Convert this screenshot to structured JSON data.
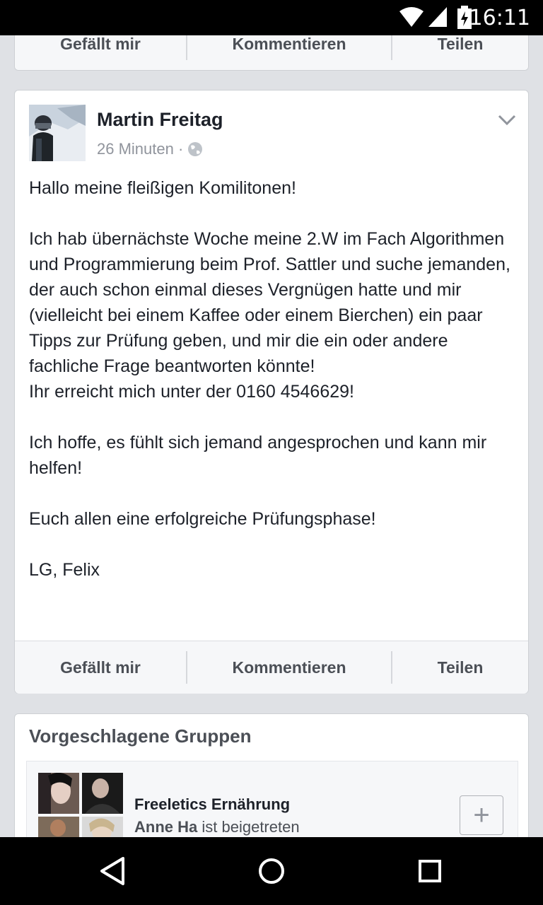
{
  "status_bar": {
    "time": "16:11"
  },
  "top_card_actions": {
    "like": "Gefällt mir",
    "comment": "Kommentieren",
    "share": "Teilen"
  },
  "post": {
    "author": "Martin Freitag",
    "time_ago": "26 Minuten",
    "separator": "·",
    "text": "Hallo meine fleißigen Komilitonen!\n\nIch hab übernächste Woche meine 2.W im Fach Algorithmen und Programmierung beim Prof. Sattler und suche jemanden, der auch schon einmal dieses Vergnügen hatte und mir (vielleicht bei einem Kaffee oder einem Bierchen) ein paar Tipps zur Prüfung geben, und mir die ein oder andere fachliche Frage beantworten könnte!\nIhr erreicht mich unter der 0160 4546629!\n\nIch hoffe, es fühlt sich jemand angesprochen und kann mir helfen!\n\nEuch allen eine erfolgreiche Prüfungsphase!\n\nLG, Felix",
    "actions": {
      "like": "Gefällt mir",
      "comment": "Kommentieren",
      "share": "Teilen"
    }
  },
  "suggested_groups": {
    "title": "Vorgeschlagene Gruppen",
    "group": {
      "name": "Freeletics Ernährung",
      "member": "Anne Ha",
      "activity": "ist beigetreten",
      "join_label": "+"
    }
  }
}
